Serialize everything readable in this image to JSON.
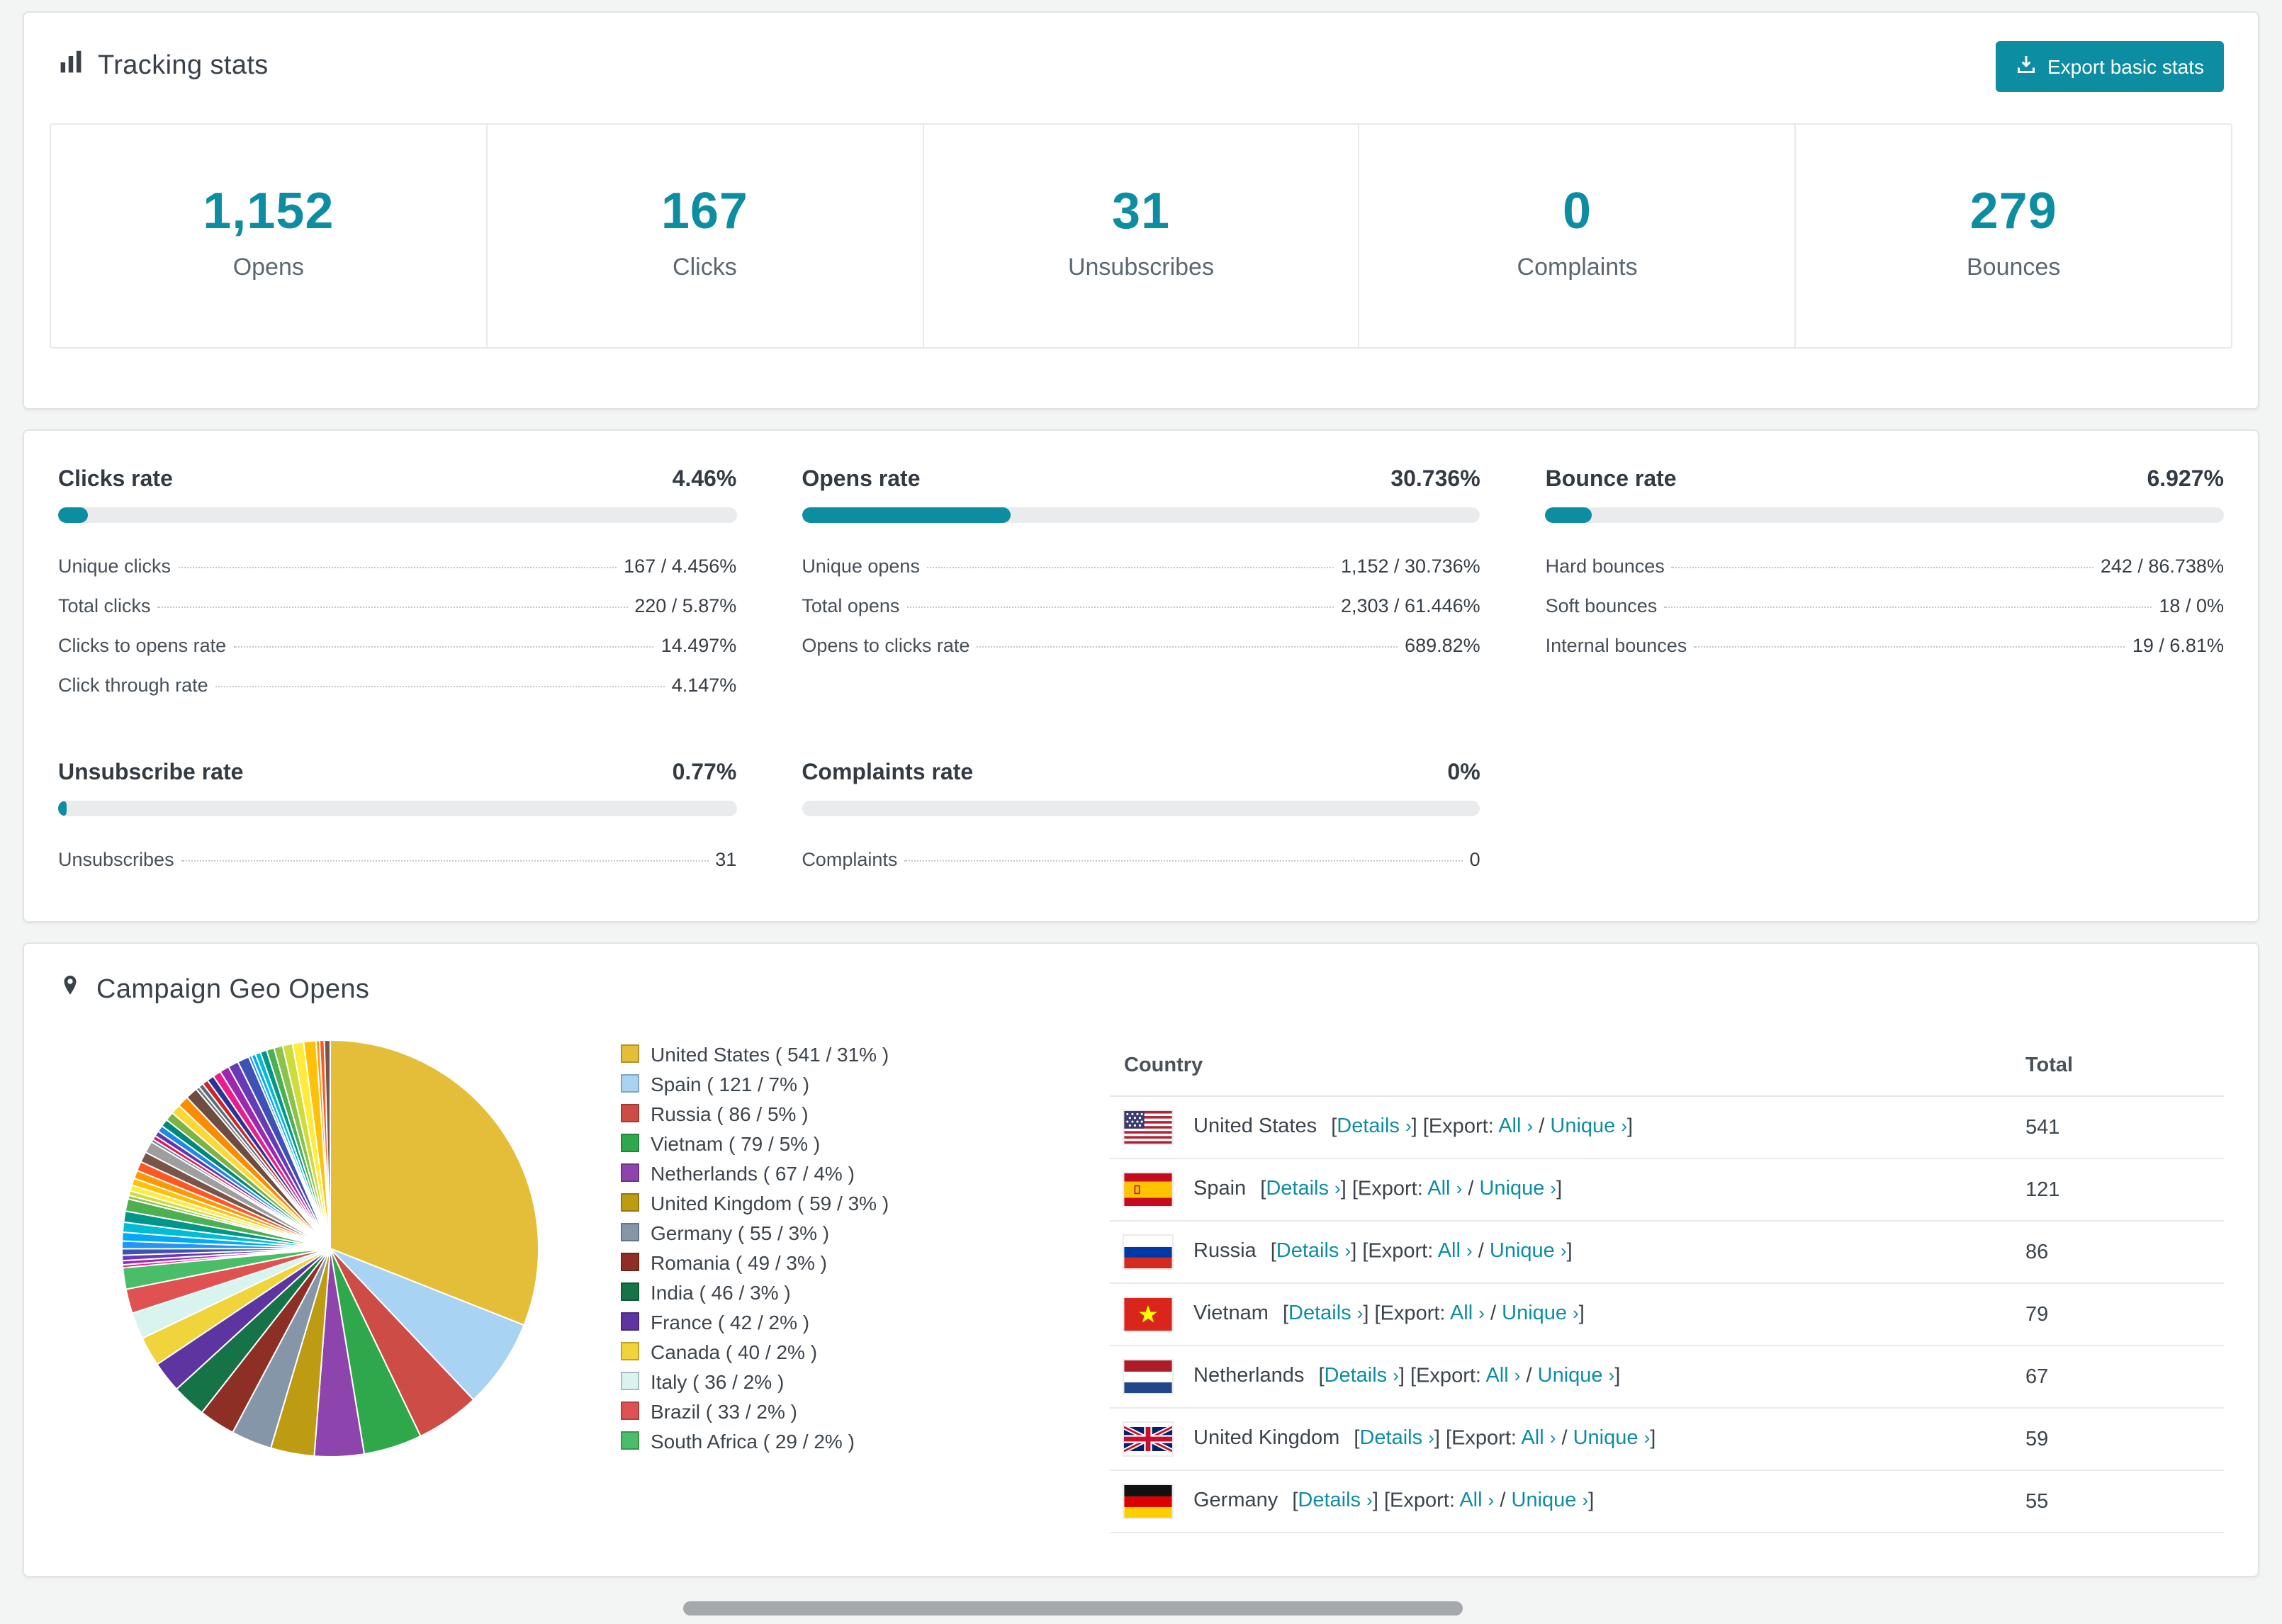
{
  "colors": {
    "accent": "#0d8da1",
    "bar_track": "#e9ebec"
  },
  "tracking": {
    "title": "Tracking stats",
    "export_button": "Export basic stats",
    "stats": [
      {
        "value": "1,152",
        "label": "Opens"
      },
      {
        "value": "167",
        "label": "Clicks"
      },
      {
        "value": "31",
        "label": "Unsubscribes"
      },
      {
        "value": "0",
        "label": "Complaints"
      },
      {
        "value": "279",
        "label": "Bounces"
      }
    ]
  },
  "rates": [
    {
      "title": "Clicks rate",
      "value": "4.46%",
      "pct": 4.46,
      "rows": [
        {
          "label": "Unique clicks",
          "value": "167 / 4.456%"
        },
        {
          "label": "Total clicks",
          "value": "220 / 5.87%"
        },
        {
          "label": "Clicks to opens rate",
          "value": "14.497%"
        },
        {
          "label": "Click through rate",
          "value": "4.147%"
        }
      ]
    },
    {
      "title": "Opens rate",
      "value": "30.736%",
      "pct": 30.736,
      "rows": [
        {
          "label": "Unique opens",
          "value": "1,152 / 30.736%"
        },
        {
          "label": "Total opens",
          "value": "2,303 / 61.446%"
        },
        {
          "label": "Opens to clicks rate",
          "value": "689.82%"
        }
      ]
    },
    {
      "title": "Bounce rate",
      "value": "6.927%",
      "pct": 6.927,
      "rows": [
        {
          "label": "Hard bounces",
          "value": "242 / 86.738%"
        },
        {
          "label": "Soft bounces",
          "value": "18 / 0%"
        },
        {
          "label": "Internal bounces",
          "value": "19 / 6.81%"
        }
      ]
    },
    {
      "title": "Unsubscribe rate",
      "value": "0.77%",
      "pct": 0.77,
      "rows": [
        {
          "label": "Unsubscribes",
          "value": "31"
        }
      ]
    },
    {
      "title": "Complaints rate",
      "value": "0%",
      "pct": 0,
      "rows": [
        {
          "label": "Complaints",
          "value": "0"
        }
      ]
    }
  ],
  "geo": {
    "title": "Campaign Geo Opens",
    "table": {
      "country_header": "Country",
      "total_header": "Total",
      "details_label": "Details",
      "export_label": "Export:",
      "all_label": "All",
      "unique_label": "Unique",
      "rows": [
        {
          "country": "United States",
          "total": "541",
          "flag": "us"
        },
        {
          "country": "Spain",
          "total": "121",
          "flag": "es"
        },
        {
          "country": "Russia",
          "total": "86",
          "flag": "ru"
        },
        {
          "country": "Vietnam",
          "total": "79",
          "flag": "vn"
        },
        {
          "country": "Netherlands",
          "total": "67",
          "flag": "nl"
        },
        {
          "country": "United Kingdom",
          "total": "59",
          "flag": "gb"
        },
        {
          "country": "Germany",
          "total": "55",
          "flag": "de"
        }
      ]
    }
  },
  "chart_data": {
    "type": "pie",
    "title": "Campaign Geo Opens",
    "legend_position": "right",
    "categories": [
      "United States",
      "Spain",
      "Russia",
      "Vietnam",
      "Netherlands",
      "United Kingdom",
      "Germany",
      "Romania",
      "India",
      "France",
      "Canada",
      "Italy",
      "Brazil",
      "South Africa"
    ],
    "values": [
      541,
      121,
      86,
      79,
      67,
      59,
      55,
      49,
      46,
      42,
      40,
      36,
      33,
      29
    ],
    "percents": [
      31,
      7,
      5,
      5,
      4,
      3,
      3,
      3,
      3,
      2,
      2,
      2,
      2,
      2
    ],
    "colors": [
      "#e4be38",
      "#a9d3f2",
      "#cd4d46",
      "#2fa84b",
      "#8e44ad",
      "#bd9b13",
      "#8496a8",
      "#8e2f26",
      "#157347",
      "#5e35a0",
      "#f0d43c",
      "#d9f3ef",
      "#e05252",
      "#49bd68"
    ],
    "others": {
      "count": 46,
      "colors": [
        "#e91e8c",
        "#9c27b0",
        "#673ab7",
        "#3f51b5",
        "#2196f3",
        "#03a9f4",
        "#00bcd4",
        "#009688",
        "#4caf50",
        "#8bc34a",
        "#cddc39",
        "#ffeb3b",
        "#ffc107",
        "#ff9800",
        "#ff5722",
        "#795548",
        "#9e9e9e",
        "#607d8b",
        "#d81b60",
        "#5e35b1",
        "#1e88e5",
        "#00897b",
        "#7cb342",
        "#fdd835",
        "#fb8c00",
        "#6d4c41",
        "#757575",
        "#546e7a",
        "#c62828",
        "#283593"
      ]
    }
  }
}
